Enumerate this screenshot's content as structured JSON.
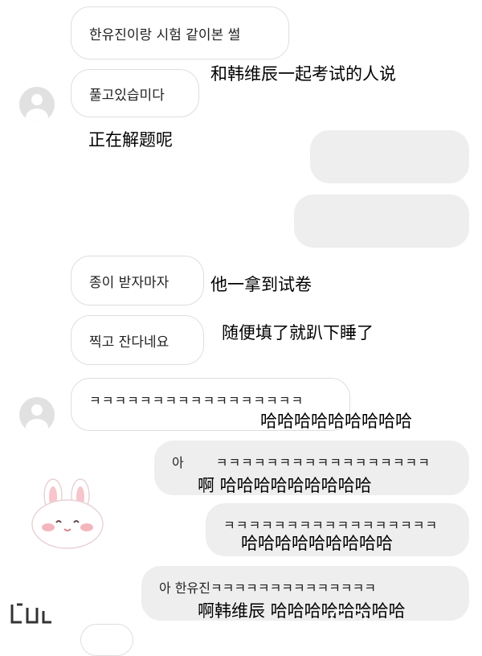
{
  "messages": {
    "m1": "한유진이랑 시험 같이본 썰",
    "m2": "풀고있습미다",
    "m3": "종이 받자마자",
    "m4": "찍고 잔다네요",
    "m5": "ㅋㅋㅋㅋㅋㅋㅋㅋㅋㅋㅋㅋㅋㅋㅋㅋㅋ",
    "m6_prefix": "아",
    "m6_laugh": "ㅋㅋㅋㅋㅋㅋㅋㅋㅋㅋㅋㅋㅋㅋㅋㅋㅋ",
    "m7": "ㅋㅋㅋㅋㅋㅋㅋㅋㅋㅋㅋㅋㅋㅋㅋㅋㅋ",
    "m8": "아 한유진ㅋㅋㅋㅋㅋㅋㅋㅋㅋㅋㅋㅋㅋㅋ"
  },
  "translations": {
    "t1": "和韩维辰一起考试的人说",
    "t2": "正在解题呢",
    "t3": "他一拿到试卷",
    "t4": "随便填了就趴下睡了",
    "t5": "哈哈哈哈哈哈哈哈哈",
    "t6": "啊 哈哈哈哈哈哈哈哈哈",
    "t7": "哈哈哈哈哈哈哈哈哈",
    "t8": "啊韩维辰 哈哈哈哈哈哈哈哈"
  },
  "icons": {
    "avatar": "default-avatar-icon",
    "sticker": "bunny-sticker-icon",
    "logo": "corner-logo-icon"
  },
  "colors": {
    "bubble_border": "#dedede",
    "bubble_grey": "#eeeeee",
    "avatar_grey": "#e1e1e1",
    "sticker_pink": "#f4b6bd"
  }
}
